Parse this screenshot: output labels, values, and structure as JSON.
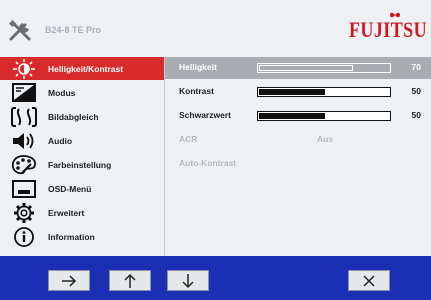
{
  "header": {
    "model": "B24-8 TE Pro",
    "brand": "FUJITSU"
  },
  "sidebar": {
    "items": [
      {
        "label": "Helligkeit/Kontrast",
        "icon": "brightness-icon",
        "active": true
      },
      {
        "label": "Modus",
        "icon": "mode-icon"
      },
      {
        "label": "Bildabgleich",
        "icon": "image-adjust-icon"
      },
      {
        "label": "Audio",
        "icon": "speaker-icon"
      },
      {
        "label": "Farbeinstellung",
        "icon": "color-palette-icon"
      },
      {
        "label": "OSD-Menü",
        "icon": "osd-menu-icon"
      },
      {
        "label": "Erweitert",
        "icon": "gear-icon"
      },
      {
        "label": "Information",
        "icon": "info-icon"
      }
    ]
  },
  "content": {
    "rows": [
      {
        "label": "Helligkeit",
        "value": "70",
        "level": 70,
        "selected": true
      },
      {
        "label": "Kontrast",
        "value": "50",
        "level": 50
      },
      {
        "label": "Schwarzwert",
        "value": "50",
        "level": 50
      },
      {
        "label": "ACR",
        "sub": "Aus",
        "disabled": true
      },
      {
        "label": "Auto-Kontrast",
        "disabled": true
      }
    ]
  },
  "footer": {
    "buttons": [
      {
        "name": "arrow-right-icon"
      },
      {
        "name": "arrow-up-icon"
      },
      {
        "name": "arrow-down-icon"
      },
      {
        "name": "close-icon"
      }
    ]
  },
  "colors": {
    "accent": "#d82a2a",
    "brand": "#cc1a22",
    "footer_bg": "#1a2fb4",
    "panel_bg": "#eef1f4"
  }
}
